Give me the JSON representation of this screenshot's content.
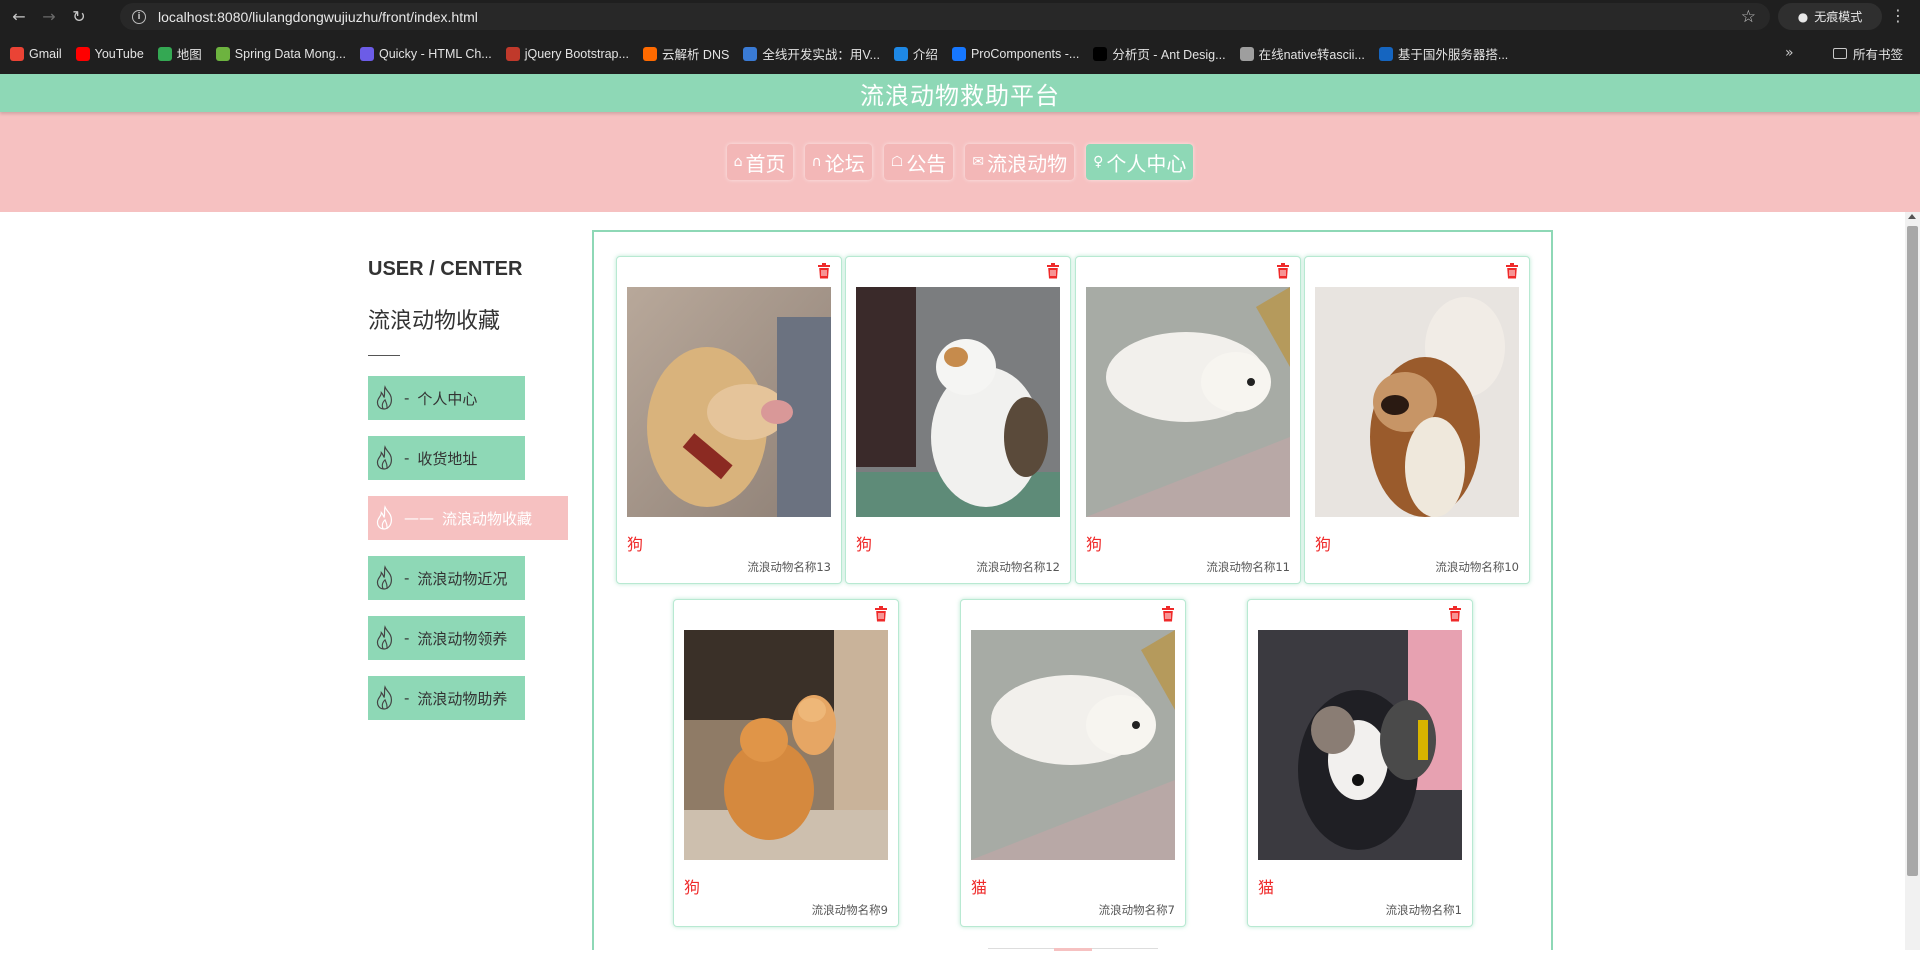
{
  "browser": {
    "url": "localhost:8080/liulangdongwujiuzhu/front/index.html",
    "incognito_label": "无痕模式",
    "bookmarks": [
      {
        "label": "Gmail",
        "color": "#ea4335"
      },
      {
        "label": "YouTube",
        "color": "#ff0000"
      },
      {
        "label": "地图",
        "color": "#34a853"
      },
      {
        "label": "Spring Data Mong...",
        "color": "#6db33f"
      },
      {
        "label": "Quicky - HTML Ch...",
        "color": "#6c5ce7"
      },
      {
        "label": "jQuery Bootstrap...",
        "color": "#c0392b"
      },
      {
        "label": "云解析 DNS",
        "color": "#ff6a00"
      },
      {
        "label": "全线开发实战：用V...",
        "color": "#3a7bd5"
      },
      {
        "label": "介绍",
        "color": "#1e88e5"
      },
      {
        "label": "ProComponents -...",
        "color": "#1677ff"
      },
      {
        "label": "分析页 - Ant Desig...",
        "color": "#000000"
      },
      {
        "label": "在线native转ascii...",
        "color": "#9e9e9e"
      },
      {
        "label": "基于国外服务器搭...",
        "color": "#1565c0"
      }
    ],
    "all_bookmarks_label": "所有书签"
  },
  "site": {
    "title": "流浪动物救助平台",
    "nav": [
      {
        "label": "首页",
        "icon": "home-icon",
        "active": false
      },
      {
        "label": "论坛",
        "icon": "forum-icon",
        "active": false
      },
      {
        "label": "公告",
        "icon": "gift-icon",
        "active": false
      },
      {
        "label": "流浪动物",
        "icon": "mail-icon",
        "active": false
      },
      {
        "label": "个人中心",
        "icon": "user-icon",
        "active": true
      }
    ]
  },
  "sidebar": {
    "title": "USER / CENTER",
    "subtitle": "流浪动物收藏",
    "items": [
      {
        "label": "个人中心",
        "active": false
      },
      {
        "label": "收货地址",
        "active": false
      },
      {
        "label": "流浪动物收藏",
        "active": true
      },
      {
        "label": "流浪动物近况",
        "active": false
      },
      {
        "label": "流浪动物领养",
        "active": false
      },
      {
        "label": "流浪动物助养",
        "active": false
      }
    ]
  },
  "favorites": [
    {
      "type": "狗",
      "name": "流浪动物名称13",
      "photo": "dog-golden-retriever"
    },
    {
      "type": "狗",
      "name": "流浪动物名称12",
      "photo": "cat-white-calico"
    },
    {
      "type": "狗",
      "name": "流浪动物名称11",
      "photo": "puppy-white-lying"
    },
    {
      "type": "狗",
      "name": "流浪动物名称10",
      "photo": "dog-pekingese"
    },
    {
      "type": "狗",
      "name": "流浪动物名称9",
      "photo": "cats-orange-pair"
    },
    {
      "type": "猫",
      "name": "流浪动物名称7",
      "photo": "puppy-white-lying"
    },
    {
      "type": "猫",
      "name": "流浪动物名称1",
      "photo": "dog-collie-glove"
    }
  ],
  "colors": {
    "mint": "#8ed8b6",
    "pink": "#f6c1c1",
    "red_text": "#ef2a2a"
  }
}
